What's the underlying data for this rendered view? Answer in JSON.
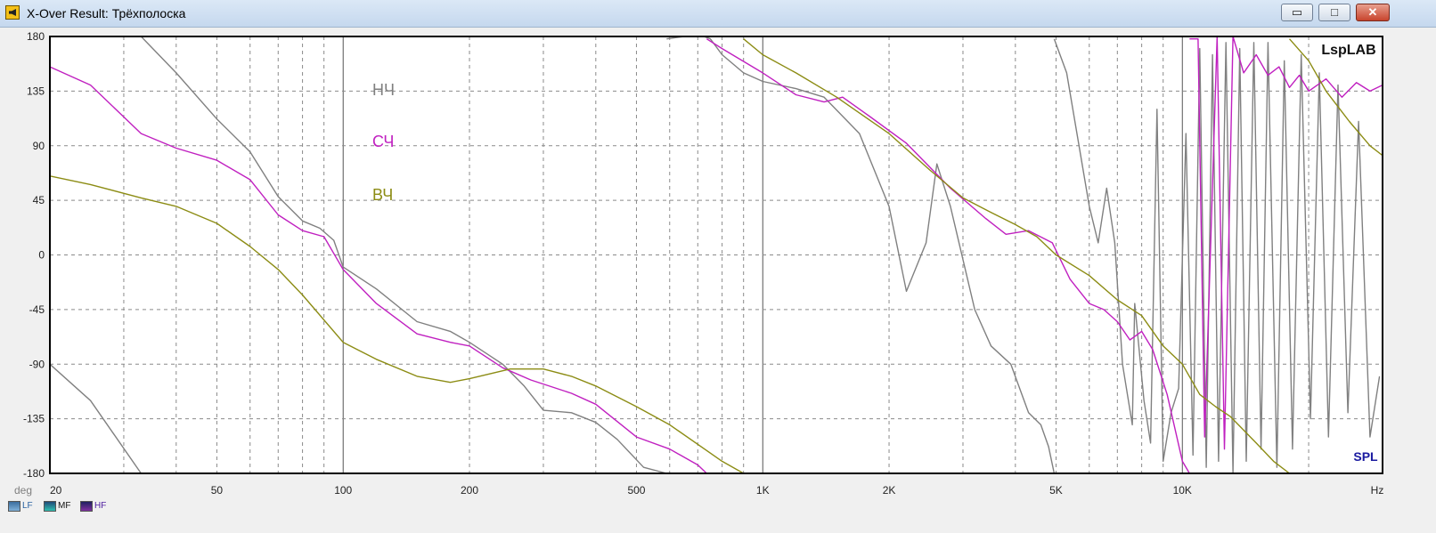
{
  "window": {
    "title": "X-Over Result: Трёхполоска",
    "minimize_glyph": "▭",
    "maximize_glyph": "□",
    "close_glyph": "✕"
  },
  "chart_data": {
    "type": "line",
    "title": "",
    "xlabel": "Hz",
    "ylabel": "deg",
    "x_scale": "log",
    "xlim": [
      20,
      30000
    ],
    "ylim": [
      -180,
      180
    ],
    "y_ticks": [
      180,
      135,
      90,
      45,
      0,
      -45,
      -90,
      -135,
      -180
    ],
    "x_ticks": [
      {
        "value": 20,
        "label": "20"
      },
      {
        "value": 50,
        "label": "50"
      },
      {
        "value": 100,
        "label": "100"
      },
      {
        "value": 200,
        "label": "200"
      },
      {
        "value": 500,
        "label": "500"
      },
      {
        "value": 1000,
        "label": "1K"
      },
      {
        "value": 2000,
        "label": "2K"
      },
      {
        "value": 5000,
        "label": "5K"
      },
      {
        "value": 10000,
        "label": "10K"
      }
    ],
    "grid": true,
    "logo": "LspLAB",
    "mode_label": "SPL",
    "annotations": [
      {
        "text": "НЧ",
        "color": "#7f7f7f"
      },
      {
        "text": "СЧ",
        "color": "#c020c0"
      },
      {
        "text": "ВЧ",
        "color": "#8c8c14"
      }
    ],
    "series": [
      {
        "name": "LF",
        "color": "#808080",
        "swatch": [
          "#3c6e9e",
          "#7fb0d8"
        ],
        "points": [
          [
            20,
            -90
          ],
          [
            25,
            -120
          ],
          [
            33,
            -180
          ],
          [
            33,
            180
          ],
          [
            40,
            150
          ],
          [
            50,
            112
          ],
          [
            60,
            85
          ],
          [
            70,
            48
          ],
          [
            80,
            28
          ],
          [
            88,
            22
          ],
          [
            95,
            12
          ],
          [
            100,
            -10
          ],
          [
            120,
            -28
          ],
          [
            150,
            -55
          ],
          [
            180,
            -63
          ],
          [
            200,
            -72
          ],
          [
            240,
            -90
          ],
          [
            270,
            -108
          ],
          [
            300,
            -128
          ],
          [
            350,
            -130
          ],
          [
            400,
            -138
          ],
          [
            450,
            -152
          ],
          [
            520,
            -175
          ],
          [
            590,
            -180
          ],
          [
            590,
            178
          ],
          [
            650,
            180
          ],
          [
            700,
            182
          ],
          [
            750,
            178
          ],
          [
            800,
            165
          ],
          [
            900,
            150
          ],
          [
            1000,
            143
          ],
          [
            1200,
            137
          ],
          [
            1400,
            130
          ],
          [
            1700,
            100
          ],
          [
            2000,
            40
          ],
          [
            2200,
            -30
          ],
          [
            2450,
            10
          ],
          [
            2600,
            75
          ],
          [
            2800,
            40
          ],
          [
            3200,
            -45
          ],
          [
            3500,
            -75
          ],
          [
            3900,
            -90
          ],
          [
            4300,
            -130
          ],
          [
            4600,
            -140
          ],
          [
            4800,
            -158
          ],
          [
            4950,
            -180
          ],
          [
            4950,
            178
          ],
          [
            5300,
            150
          ],
          [
            6000,
            40
          ],
          [
            6300,
            10
          ],
          [
            6600,
            55
          ],
          [
            6900,
            10
          ],
          [
            7200,
            -90
          ],
          [
            7600,
            -140
          ],
          [
            7700,
            -40
          ],
          [
            8100,
            -120
          ],
          [
            8400,
            -155
          ],
          [
            8700,
            120
          ],
          [
            9000,
            -170
          ],
          [
            9400,
            -130
          ],
          [
            9800,
            -110
          ],
          [
            10200,
            100
          ],
          [
            10600,
            -165
          ],
          [
            11000,
            170
          ],
          [
            11400,
            -175
          ],
          [
            11800,
            165
          ],
          [
            12200,
            -170
          ],
          [
            12700,
            175
          ],
          [
            13200,
            -180
          ],
          [
            13700,
            170
          ],
          [
            14200,
            -170
          ],
          [
            14800,
            175
          ],
          [
            15400,
            -160
          ],
          [
            16000,
            175
          ],
          [
            16800,
            -175
          ],
          [
            17500,
            160
          ],
          [
            18300,
            -160
          ],
          [
            19200,
            165
          ],
          [
            20200,
            -135
          ],
          [
            21200,
            150
          ],
          [
            22300,
            -150
          ],
          [
            23500,
            140
          ],
          [
            24800,
            -130
          ],
          [
            26300,
            110
          ],
          [
            28000,
            -150
          ],
          [
            29500,
            -100
          ]
        ]
      },
      {
        "name": "MF",
        "color": "#c020c0",
        "swatch": [
          "#204a78",
          "#30c0b0"
        ],
        "points": [
          [
            20,
            155
          ],
          [
            25,
            140
          ],
          [
            33,
            100
          ],
          [
            40,
            88
          ],
          [
            50,
            78
          ],
          [
            60,
            62
          ],
          [
            70,
            33
          ],
          [
            80,
            20
          ],
          [
            90,
            15
          ],
          [
            100,
            -12
          ],
          [
            120,
            -40
          ],
          [
            150,
            -65
          ],
          [
            180,
            -72
          ],
          [
            200,
            -75
          ],
          [
            240,
            -93
          ],
          [
            280,
            -103
          ],
          [
            350,
            -114
          ],
          [
            400,
            -123
          ],
          [
            500,
            -150
          ],
          [
            600,
            -160
          ],
          [
            700,
            -173
          ],
          [
            735,
            -180
          ],
          [
            735,
            178
          ],
          [
            800,
            170
          ],
          [
            1000,
            150
          ],
          [
            1200,
            132
          ],
          [
            1400,
            126
          ],
          [
            1550,
            130
          ],
          [
            1800,
            114
          ],
          [
            2200,
            92
          ],
          [
            2800,
            55
          ],
          [
            3400,
            30
          ],
          [
            3800,
            17
          ],
          [
            4300,
            20
          ],
          [
            4900,
            10
          ],
          [
            5400,
            -20
          ],
          [
            6000,
            -40
          ],
          [
            6500,
            -45
          ],
          [
            7000,
            -55
          ],
          [
            7500,
            -70
          ],
          [
            8000,
            -63
          ],
          [
            8500,
            -78
          ],
          [
            9200,
            -115
          ],
          [
            10000,
            -170
          ],
          [
            10400,
            -180
          ],
          [
            10400,
            178
          ],
          [
            10900,
            178
          ],
          [
            11300,
            -150
          ],
          [
            12100,
            180
          ],
          [
            12600,
            -160
          ],
          [
            13200,
            180
          ],
          [
            14000,
            150
          ],
          [
            15000,
            165
          ],
          [
            16000,
            148
          ],
          [
            17000,
            155
          ],
          [
            18000,
            138
          ],
          [
            19000,
            148
          ],
          [
            20000,
            135
          ],
          [
            22000,
            145
          ],
          [
            24000,
            130
          ],
          [
            26000,
            142
          ],
          [
            28000,
            135
          ],
          [
            30000,
            140
          ]
        ]
      },
      {
        "name": "HF",
        "color": "#8c8c14",
        "swatch": [
          "#202060",
          "#8030a0"
        ],
        "points": [
          [
            20,
            65
          ],
          [
            25,
            58
          ],
          [
            33,
            47
          ],
          [
            40,
            40
          ],
          [
            50,
            26
          ],
          [
            60,
            7
          ],
          [
            70,
            -12
          ],
          [
            80,
            -33
          ],
          [
            100,
            -72
          ],
          [
            120,
            -86
          ],
          [
            150,
            -100
          ],
          [
            180,
            -105
          ],
          [
            200,
            -102
          ],
          [
            250,
            -94
          ],
          [
            300,
            -94
          ],
          [
            350,
            -100
          ],
          [
            400,
            -108
          ],
          [
            500,
            -125
          ],
          [
            600,
            -140
          ],
          [
            800,
            -170
          ],
          [
            900,
            -180
          ],
          [
            900,
            178
          ],
          [
            1000,
            165
          ],
          [
            1200,
            150
          ],
          [
            1500,
            130
          ],
          [
            2000,
            100
          ],
          [
            2500,
            70
          ],
          [
            3000,
            47
          ],
          [
            3500,
            35
          ],
          [
            4000,
            25
          ],
          [
            4500,
            15
          ],
          [
            5000,
            0
          ],
          [
            6000,
            -17
          ],
          [
            7000,
            -37
          ],
          [
            8000,
            -50
          ],
          [
            9000,
            -75
          ],
          [
            10000,
            -90
          ],
          [
            11000,
            -115
          ],
          [
            12000,
            -125
          ],
          [
            13000,
            -133
          ],
          [
            15000,
            -155
          ],
          [
            16500,
            -170
          ],
          [
            18000,
            -180
          ],
          [
            18000,
            178
          ],
          [
            20000,
            160
          ],
          [
            22000,
            135
          ],
          [
            25000,
            110
          ],
          [
            28000,
            90
          ],
          [
            30000,
            82
          ]
        ]
      }
    ]
  }
}
